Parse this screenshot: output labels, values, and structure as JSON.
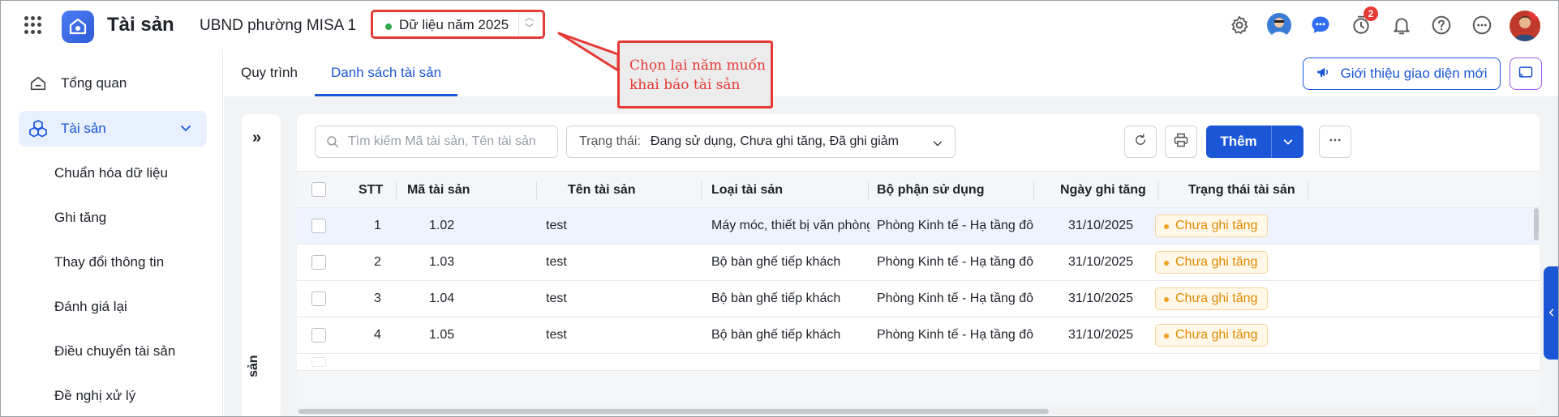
{
  "header": {
    "app_title": "Tài sản",
    "org_name": "UBND phường MISA 1",
    "year_selector": "Dữ liệu năm 2025",
    "timer_badge": "2",
    "avatar_badge": "!"
  },
  "sidebar": {
    "items": [
      {
        "label": "Tổng quan"
      },
      {
        "label": "Tài sản"
      }
    ],
    "sub_items": [
      {
        "label": "Chuẩn hóa dữ liệu"
      },
      {
        "label": "Ghi tăng"
      },
      {
        "label": "Thay đổi thông tin"
      },
      {
        "label": "Đánh giá lại"
      },
      {
        "label": "Điều chuyển tài sản"
      },
      {
        "label": "Đề nghị xử lý"
      }
    ]
  },
  "tabs": [
    {
      "label": "Quy trình"
    },
    {
      "label": "Danh sách tài sản"
    }
  ],
  "toolbar": {
    "intro_label": "Giới thiệu giao diện mới",
    "search_placeholder": "Tìm kiếm Mã tài sản, Tên tài sản",
    "status_label": "Trạng thái:",
    "status_value": "Đang sử dụng, Chưa ghi tăng, Đã ghi giảm",
    "add_label": "Thêm",
    "collapse_icon": "»",
    "collapse_vertical_text": "sản"
  },
  "table": {
    "columns": [
      "STT",
      "Mã tài sản",
      "Tên tài sản",
      "Loại tài sản",
      "Bộ phận sử dụng",
      "Ngày ghi tăng",
      "Trạng thái tài sản"
    ],
    "rows": [
      {
        "stt": "1",
        "code": "1.02",
        "name": "test",
        "type": "Máy móc, thiết bị văn phòng ...",
        "dept": "Phòng Kinh tế - Hạ tầng đô t...",
        "date": "31/10/2025",
        "status": "Chưa ghi tăng"
      },
      {
        "stt": "2",
        "code": "1.03",
        "name": "test",
        "type": "Bộ bàn ghế tiếp khách",
        "dept": "Phòng Kinh tế - Hạ tầng đô t...",
        "date": "31/10/2025",
        "status": "Chưa ghi tăng"
      },
      {
        "stt": "3",
        "code": "1.04",
        "name": "test",
        "type": "Bộ bàn ghế tiếp khách",
        "dept": "Phòng Kinh tế - Hạ tầng đô t...",
        "date": "31/10/2025",
        "status": "Chưa ghi tăng"
      },
      {
        "stt": "4",
        "code": "1.05",
        "name": "test",
        "type": "Bộ bàn ghế tiếp khách",
        "dept": "Phòng Kinh tế - Hạ tầng đô t...",
        "date": "31/10/2025",
        "status": "Chưa ghi tăng"
      }
    ]
  },
  "annotation": {
    "line1": "Chọn lại năm muốn",
    "line2": "khai báo tài sản"
  },
  "colors": {
    "primary": "#1a56d6",
    "annotation_red": "#e53935",
    "status_orange": "#e08a00"
  }
}
